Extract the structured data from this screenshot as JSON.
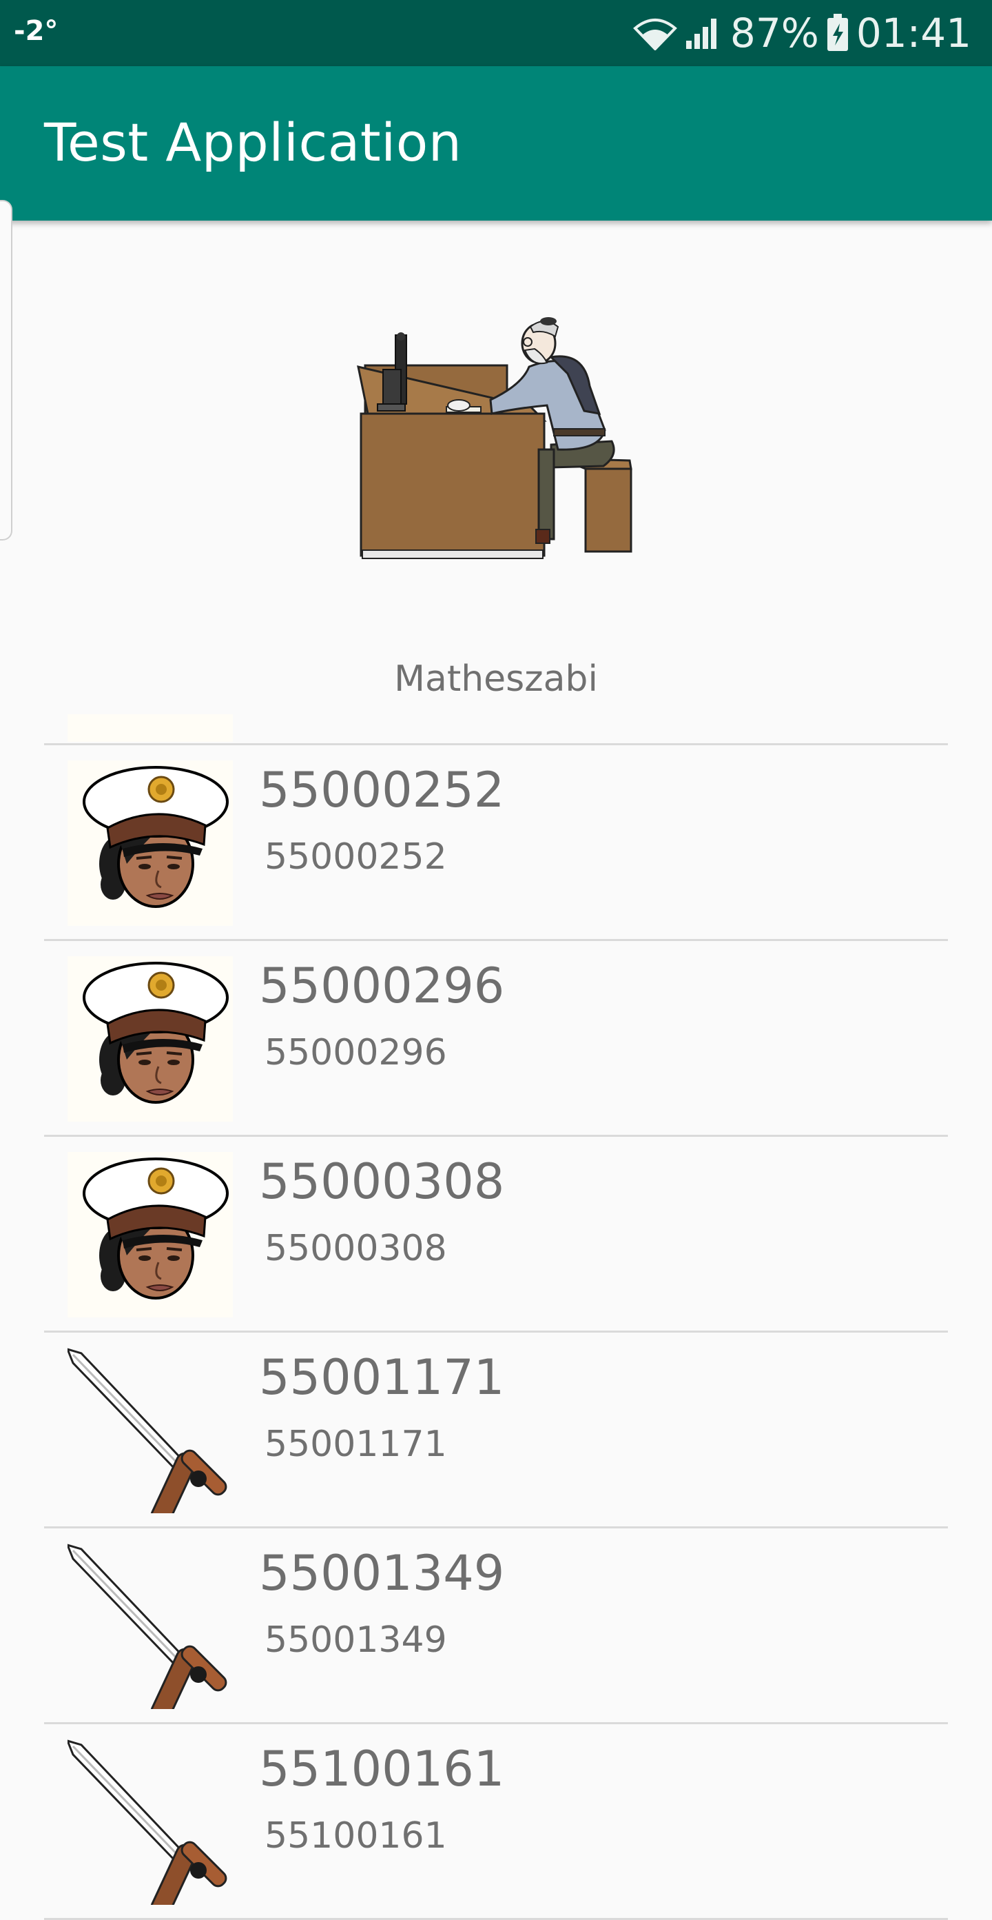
{
  "status_bar": {
    "temperature": "-2°",
    "battery": "87%",
    "time": "01:41",
    "icons": [
      "wifi-icon",
      "signal-icon",
      "battery-charging-icon"
    ]
  },
  "app_bar": {
    "title": "Test Application",
    "color": "#008577",
    "status_color": "#00594d"
  },
  "profile": {
    "name": "Matheszabi",
    "image": "man-at-computer-desk"
  },
  "list": {
    "items": [
      {
        "title": "55000252",
        "subtitle": "55000252",
        "icon": "police-officer-icon"
      },
      {
        "title": "55000296",
        "subtitle": "55000296",
        "icon": "police-officer-icon"
      },
      {
        "title": "55000308",
        "subtitle": "55000308",
        "icon": "police-officer-icon"
      },
      {
        "title": "55001171",
        "subtitle": "55001171",
        "icon": "sword-icon"
      },
      {
        "title": "55001349",
        "subtitle": "55001349",
        "icon": "sword-icon"
      },
      {
        "title": "55100161",
        "subtitle": "55100161",
        "icon": "sword-icon"
      }
    ]
  }
}
